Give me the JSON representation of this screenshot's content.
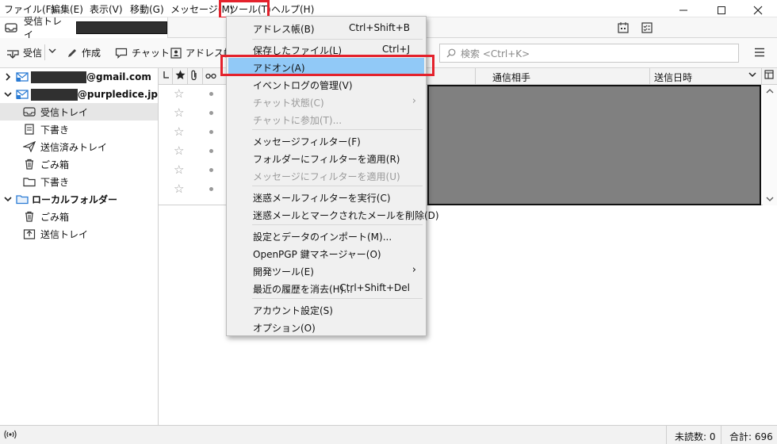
{
  "menubar": {
    "items": [
      "ファイル(F)",
      "編集(E)",
      "表示(V)",
      "移動(G)",
      "メッセージ(M)",
      "ツール(T)",
      "ヘルプ(H)"
    ]
  },
  "tab": {
    "label": "受信トレイ"
  },
  "toolbar": {
    "get_mail": "受信",
    "write": "作成",
    "chat": "チャット",
    "address_book": "アドレス帳",
    "search_placeholder": "検索 <Ctrl+K>"
  },
  "folders": {
    "account1_suffix": "@gmail.com",
    "account2_suffix": "@purpledice.jp",
    "items": [
      "受信トレイ",
      "下書き",
      "送信済みトレイ",
      "ごみ箱",
      "下書き"
    ],
    "local_label": "ローカルフォルダー",
    "local_items": [
      "ごみ箱",
      "送信トレイ"
    ]
  },
  "thread": {
    "col_correspondent": "通信相手",
    "col_date": "送信日時"
  },
  "tools_menu": {
    "groups": [
      [
        {
          "label": "アドレス帳(B)",
          "shortcut": "Ctrl+Shift+B"
        }
      ],
      [
        {
          "label": "保存したファイル(L)",
          "shortcut": "Ctrl+J"
        },
        {
          "label": "アドオン(A)",
          "highlighted": true
        },
        {
          "label": "イベントログの管理(V)"
        },
        {
          "label": "チャット状態(C)",
          "disabled": true,
          "submenu": true
        },
        {
          "label": "チャットに参加(T)...",
          "disabled": true
        }
      ],
      [
        {
          "label": "メッセージフィルター(F)"
        },
        {
          "label": "フォルダーにフィルターを適用(R)"
        },
        {
          "label": "メッセージにフィルターを適用(U)",
          "disabled": true
        }
      ],
      [
        {
          "label": "迷惑メールフィルターを実行(C)"
        },
        {
          "label": "迷惑メールとマークされたメールを削除(D)"
        }
      ],
      [
        {
          "label": "設定とデータのインポート(M)..."
        },
        {
          "label": "OpenPGP 鍵マネージャー(O)"
        },
        {
          "label": "開発ツール(E)",
          "submenu": true
        },
        {
          "label": "最近の履歴を消去(H)...",
          "shortcut": "Ctrl+Shift+Del"
        }
      ],
      [
        {
          "label": "アカウント設定(S)"
        },
        {
          "label": "オプション(O)"
        }
      ]
    ]
  },
  "status": {
    "unread": "未読数: 0",
    "total": "合計: 696"
  },
  "colors": {
    "highlight_box": "#e4222c",
    "menu_highlight": "#91c9f7"
  }
}
